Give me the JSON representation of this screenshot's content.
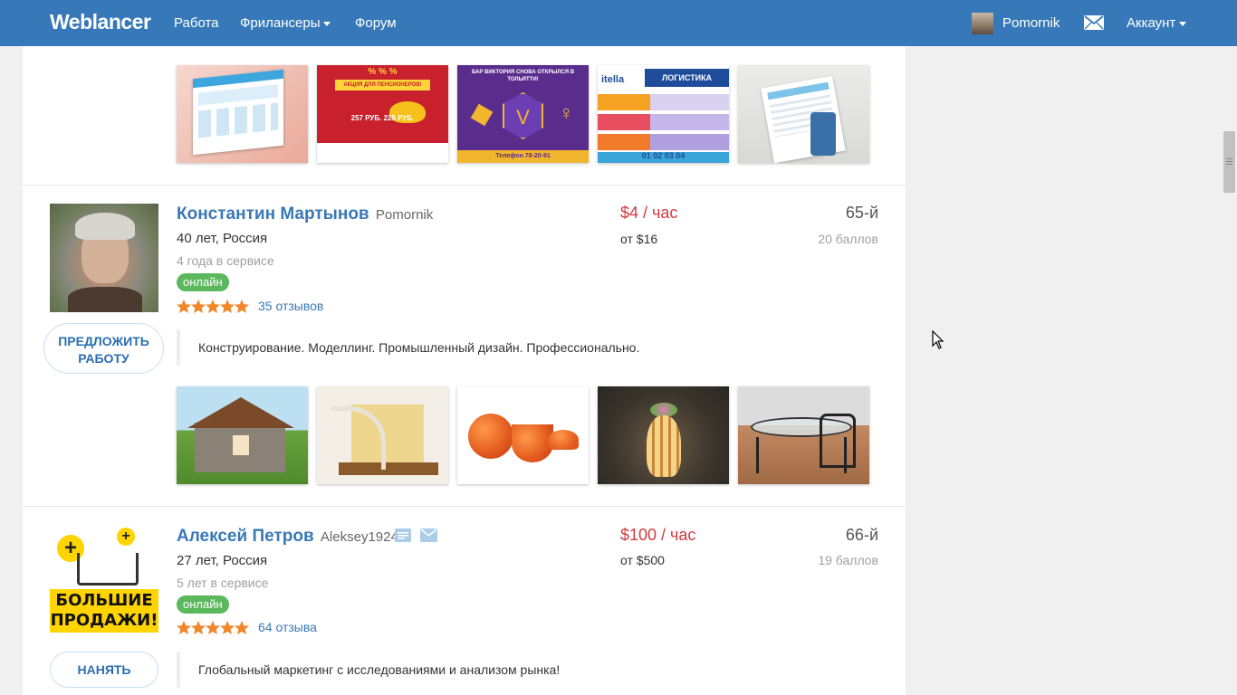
{
  "navbar": {
    "logo": "Weblancer",
    "links": [
      "Работа",
      "Фрилансеры",
      "Форум"
    ],
    "username": "Pomornik",
    "account_label": "Аккаунт",
    "icons": [
      "avatar",
      "mail-icon",
      "caret-down-icon"
    ],
    "bg_color": "#3779b8"
  },
  "top_portfolio": {
    "thumb_texts": [
      [
        "",
        "",
        ""
      ],
      [
        "% % %",
        "АКЦИЯ ДЛЯ ПЕНСИОНЕРОВ!",
        "257 РУБ.  225 РУБ."
      ],
      [
        "БАР ВИКТОРИЯ СНОВА ОТКРЫЛСЯ В ТОЛЬЯТТИ!",
        "V",
        "Телефон 78-20-91"
      ],
      [
        "itella",
        "ЛОГИСТИКА",
        "01  02  03  04"
      ],
      [
        "",
        "",
        ""
      ]
    ]
  },
  "freelancers": [
    {
      "name": "Константин Мартынов",
      "login": "Pomornik",
      "age_country": "40 лет, Россия",
      "experience": "4 года в сервисе",
      "status": "онлайн",
      "rating_stars": 5,
      "reviews": "35 отзывов",
      "price": "$4 / час",
      "min_price": "от $16",
      "rank": "65-й",
      "points": "20 баллов",
      "button": [
        "ПРЕДЛОЖИТЬ",
        "РАБОТУ"
      ],
      "description": "Конструирование. Моделлинг. Промышленный дизайн. Профессионально."
    },
    {
      "name": "Алексей Петров",
      "login": "Aleksey1924",
      "age_country": "27 лет, Россия",
      "experience": "5 лет в сервисе",
      "status": "онлайн",
      "rating_stars": 5,
      "reviews": "64 отзыва",
      "price": "$100 / час",
      "min_price": "от $500",
      "rank": "66-й",
      "points": "19 баллов",
      "button": [
        "НАНЯТЬ"
      ],
      "avatar_text": [
        "БОЛЬШИЕ",
        "ПРОДАЖИ!"
      ],
      "description": "Глобальный маркетинг с исследованиями и анализом рынка!"
    }
  ]
}
